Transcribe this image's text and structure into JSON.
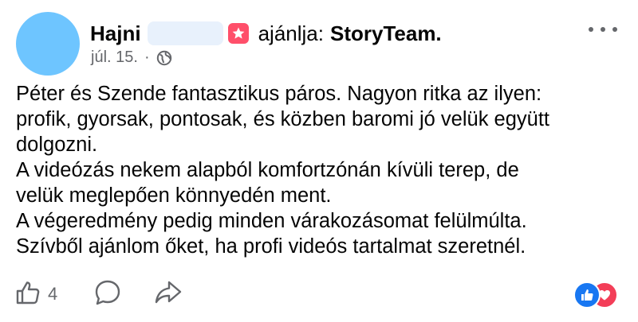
{
  "post": {
    "author": "Hajni",
    "recommends_text": "ajánlja:",
    "page_name": "StoryTeam.",
    "date": "júl. 15.",
    "separator": "·",
    "text": "Péter és Szende fantasztikus páros. Nagyon ritka az ilyen:\nprofik, gyorsak, pontosak, és közben baromi jó velük együtt\ndolgozni.\nA videózás nekem alapból komfortzónán kívüli terep, de\nvelük meglepően könnyedén ment.\nA végeredmény pedig minden várakozásomat felülmúlta.\nSzívből ajánlom őket, ha profi videós tartalmat szeretnél."
  },
  "actions": {
    "like_count": "4"
  },
  "icons": {
    "recommend": "recommend-star-icon",
    "privacy": "globe-icon",
    "more": "more-options-icon",
    "like": "thumbs-up-icon",
    "comment": "comment-icon",
    "share": "share-icon",
    "reaction_like": "like-reaction-icon",
    "reaction_love": "love-reaction-icon"
  },
  "colors": {
    "avatar": "#6ec5ff",
    "recommend_badge": "#ff4f6a",
    "secondary_text": "#65676b",
    "like_blue": "#1877f2",
    "love_red": "#f33e58"
  }
}
